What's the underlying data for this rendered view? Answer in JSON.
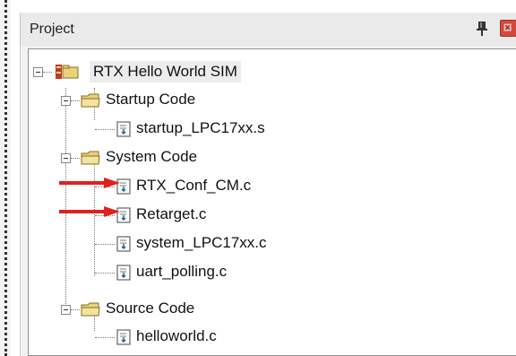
{
  "panel": {
    "title": "Project"
  },
  "tree": {
    "root": {
      "label": "RTX Hello World SIM",
      "icon": "project-icon"
    },
    "groups": [
      {
        "label": "Startup Code",
        "icon": "folder-icon",
        "files": [
          {
            "label": "startup_LPC17xx.s",
            "icon": "file-icon"
          }
        ]
      },
      {
        "label": "System Code",
        "icon": "folder-icon",
        "files": [
          {
            "label": "RTX_Conf_CM.c",
            "icon": "file-icon",
            "highlighted_by_arrow": true
          },
          {
            "label": "Retarget.c",
            "icon": "file-icon",
            "highlighted_by_arrow": true
          },
          {
            "label": "system_LPC17xx.c",
            "icon": "file-icon"
          },
          {
            "label": "uart_polling.c",
            "icon": "file-icon"
          }
        ]
      },
      {
        "label": "Source Code",
        "icon": "folder-icon",
        "files": [
          {
            "label": "helloworld.c",
            "icon": "file-icon"
          }
        ]
      }
    ]
  },
  "colors": {
    "arrow": "#e02020",
    "close_button": "#d24a3c",
    "folder": "#e8d27a"
  }
}
